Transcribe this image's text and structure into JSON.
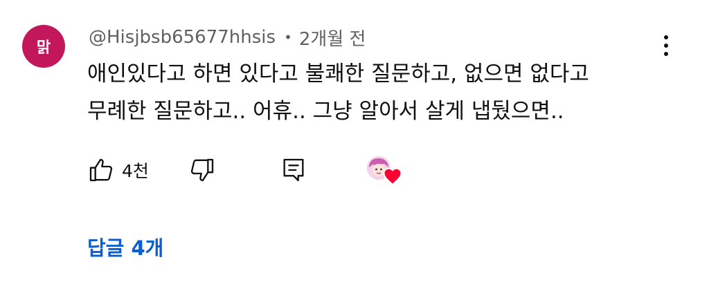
{
  "comment": {
    "avatar_text": "맑",
    "author": "@Hisjbsb65677hhsis",
    "separator": "•",
    "time": "2개월 전",
    "lines": [
      "애인있다고 하면 있다고 불쾌한 질문하고, 없으면 없다고",
      "무례한 질문하고.. 어휴.. 그냥 알아서 살게 냅뒀으면.."
    ],
    "like_count": "4천",
    "replies_label": "답글 4개"
  },
  "icons": {
    "like": "thumbs-up-icon",
    "dislike": "thumbs-down-icon",
    "reply": "comment-reply-icon",
    "menu": "more-vertical-icon",
    "heart": "creator-heart-icon"
  },
  "colors": {
    "avatar_bg": "#c2185b",
    "link": "#065fd4",
    "heart": "#ff0033",
    "meta_text": "#606060"
  }
}
